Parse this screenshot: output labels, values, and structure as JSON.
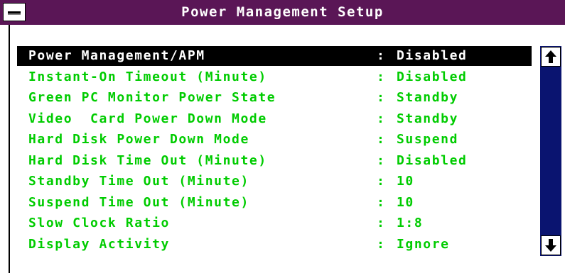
{
  "window": {
    "title": "Power Management Setup"
  },
  "settings": [
    {
      "label": "Power Management/APM",
      "value": "Disabled"
    },
    {
      "label": "Instant-On Timeout (Minute)",
      "value": "Disabled"
    },
    {
      "label": "Green PC Monitor Power State",
      "value": "Standby"
    },
    {
      "label": "Video  Card Power Down Mode",
      "value": "Standby"
    },
    {
      "label": "Hard Disk Power Down Mode",
      "value": "Suspend"
    },
    {
      "label": "Hard Disk Time Out (Minute)",
      "value": "Disabled"
    },
    {
      "label": "Standby Time Out (Minute)",
      "value": "10"
    },
    {
      "label": "Suspend Time Out (Minute)",
      "value": "10"
    },
    {
      "label": "Slow Clock Ratio",
      "value": "1:8"
    },
    {
      "label": "Display Activity",
      "value": "Ignore"
    }
  ],
  "separator": ":",
  "selected_index": 0,
  "icons": {
    "system_menu": "system-menu-icon",
    "scroll_up": "arrow-up-icon",
    "scroll_down": "arrow-down-icon"
  },
  "colors": {
    "titlebar": "#5a1656",
    "setting_text": "#00cc00",
    "selected_bg": "#000000",
    "selected_text": "#ffffff",
    "scrollbar": "#0a1470"
  }
}
